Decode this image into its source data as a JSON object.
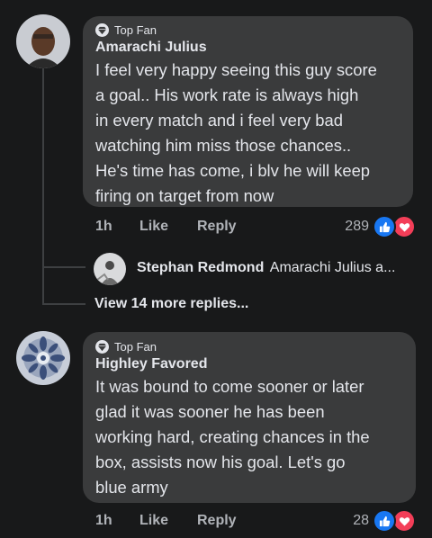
{
  "comments": [
    {
      "badge": "Top Fan",
      "author": "Amarachi Julius",
      "lines": [
        "I feel very happy seeing this guy score",
        "a  goal.. His work rate is always high",
        "in every match and i feel very bad",
        "watching him miss those chances..",
        "He's time has come, i blv he will keep",
        "firing on target from now"
      ],
      "time": "1h",
      "like_label": "Like",
      "reply_label": "Reply",
      "reaction_count": "289"
    },
    {
      "badge": "Top Fan",
      "author": "Highley Favored",
      "lines": [
        "It was bound to come sooner or later",
        "glad it was sooner he has been",
        "working hard, creating chances in the",
        "box, assists now his goal. Let's go",
        "blue army"
      ],
      "time": "1h",
      "like_label": "Like",
      "reply_label": "Reply",
      "reaction_count": "28"
    }
  ],
  "reply_preview": {
    "author": "Stephan Redmond",
    "snippet": "Amarachi Julius a..."
  },
  "view_more": "View 14 more replies...",
  "colors": {
    "background": "#18191a",
    "bubble": "#3a3b3c",
    "text": "#e4e6eb",
    "muted": "#b0b3b8",
    "like_blue": "#1877f2",
    "love_red": "#f33e58"
  },
  "icons": [
    "diamond-icon",
    "like-reaction-icon",
    "love-reaction-icon"
  ]
}
